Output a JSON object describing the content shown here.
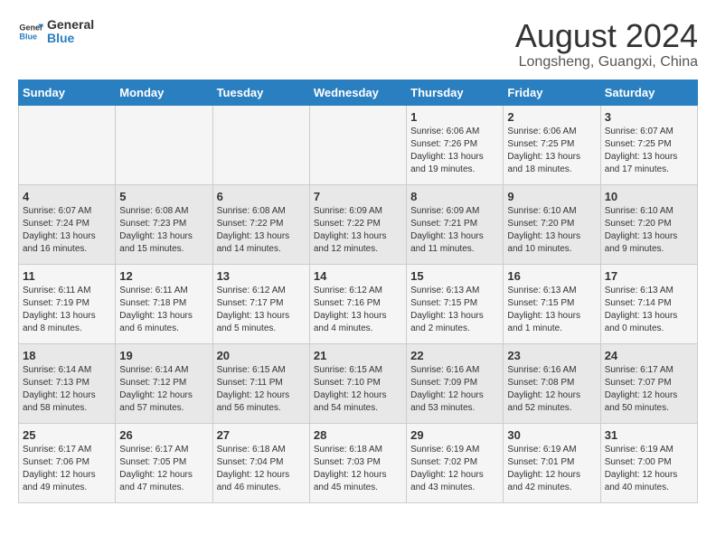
{
  "logo": {
    "line1": "General",
    "line2": "Blue"
  },
  "title": "August 2024",
  "location": "Longsheng, Guangxi, China",
  "weekdays": [
    "Sunday",
    "Monday",
    "Tuesday",
    "Wednesday",
    "Thursday",
    "Friday",
    "Saturday"
  ],
  "weeks": [
    [
      {
        "day": "",
        "text": ""
      },
      {
        "day": "",
        "text": ""
      },
      {
        "day": "",
        "text": ""
      },
      {
        "day": "",
        "text": ""
      },
      {
        "day": "1",
        "text": "Sunrise: 6:06 AM\nSunset: 7:26 PM\nDaylight: 13 hours\nand 19 minutes."
      },
      {
        "day": "2",
        "text": "Sunrise: 6:06 AM\nSunset: 7:25 PM\nDaylight: 13 hours\nand 18 minutes."
      },
      {
        "day": "3",
        "text": "Sunrise: 6:07 AM\nSunset: 7:25 PM\nDaylight: 13 hours\nand 17 minutes."
      }
    ],
    [
      {
        "day": "4",
        "text": "Sunrise: 6:07 AM\nSunset: 7:24 PM\nDaylight: 13 hours\nand 16 minutes."
      },
      {
        "day": "5",
        "text": "Sunrise: 6:08 AM\nSunset: 7:23 PM\nDaylight: 13 hours\nand 15 minutes."
      },
      {
        "day": "6",
        "text": "Sunrise: 6:08 AM\nSunset: 7:22 PM\nDaylight: 13 hours\nand 14 minutes."
      },
      {
        "day": "7",
        "text": "Sunrise: 6:09 AM\nSunset: 7:22 PM\nDaylight: 13 hours\nand 12 minutes."
      },
      {
        "day": "8",
        "text": "Sunrise: 6:09 AM\nSunset: 7:21 PM\nDaylight: 13 hours\nand 11 minutes."
      },
      {
        "day": "9",
        "text": "Sunrise: 6:10 AM\nSunset: 7:20 PM\nDaylight: 13 hours\nand 10 minutes."
      },
      {
        "day": "10",
        "text": "Sunrise: 6:10 AM\nSunset: 7:20 PM\nDaylight: 13 hours\nand 9 minutes."
      }
    ],
    [
      {
        "day": "11",
        "text": "Sunrise: 6:11 AM\nSunset: 7:19 PM\nDaylight: 13 hours\nand 8 minutes."
      },
      {
        "day": "12",
        "text": "Sunrise: 6:11 AM\nSunset: 7:18 PM\nDaylight: 13 hours\nand 6 minutes."
      },
      {
        "day": "13",
        "text": "Sunrise: 6:12 AM\nSunset: 7:17 PM\nDaylight: 13 hours\nand 5 minutes."
      },
      {
        "day": "14",
        "text": "Sunrise: 6:12 AM\nSunset: 7:16 PM\nDaylight: 13 hours\nand 4 minutes."
      },
      {
        "day": "15",
        "text": "Sunrise: 6:13 AM\nSunset: 7:15 PM\nDaylight: 13 hours\nand 2 minutes."
      },
      {
        "day": "16",
        "text": "Sunrise: 6:13 AM\nSunset: 7:15 PM\nDaylight: 13 hours\nand 1 minute."
      },
      {
        "day": "17",
        "text": "Sunrise: 6:13 AM\nSunset: 7:14 PM\nDaylight: 13 hours\nand 0 minutes."
      }
    ],
    [
      {
        "day": "18",
        "text": "Sunrise: 6:14 AM\nSunset: 7:13 PM\nDaylight: 12 hours\nand 58 minutes."
      },
      {
        "day": "19",
        "text": "Sunrise: 6:14 AM\nSunset: 7:12 PM\nDaylight: 12 hours\nand 57 minutes."
      },
      {
        "day": "20",
        "text": "Sunrise: 6:15 AM\nSunset: 7:11 PM\nDaylight: 12 hours\nand 56 minutes."
      },
      {
        "day": "21",
        "text": "Sunrise: 6:15 AM\nSunset: 7:10 PM\nDaylight: 12 hours\nand 54 minutes."
      },
      {
        "day": "22",
        "text": "Sunrise: 6:16 AM\nSunset: 7:09 PM\nDaylight: 12 hours\nand 53 minutes."
      },
      {
        "day": "23",
        "text": "Sunrise: 6:16 AM\nSunset: 7:08 PM\nDaylight: 12 hours\nand 52 minutes."
      },
      {
        "day": "24",
        "text": "Sunrise: 6:17 AM\nSunset: 7:07 PM\nDaylight: 12 hours\nand 50 minutes."
      }
    ],
    [
      {
        "day": "25",
        "text": "Sunrise: 6:17 AM\nSunset: 7:06 PM\nDaylight: 12 hours\nand 49 minutes."
      },
      {
        "day": "26",
        "text": "Sunrise: 6:17 AM\nSunset: 7:05 PM\nDaylight: 12 hours\nand 47 minutes."
      },
      {
        "day": "27",
        "text": "Sunrise: 6:18 AM\nSunset: 7:04 PM\nDaylight: 12 hours\nand 46 minutes."
      },
      {
        "day": "28",
        "text": "Sunrise: 6:18 AM\nSunset: 7:03 PM\nDaylight: 12 hours\nand 45 minutes."
      },
      {
        "day": "29",
        "text": "Sunrise: 6:19 AM\nSunset: 7:02 PM\nDaylight: 12 hours\nand 43 minutes."
      },
      {
        "day": "30",
        "text": "Sunrise: 6:19 AM\nSunset: 7:01 PM\nDaylight: 12 hours\nand 42 minutes."
      },
      {
        "day": "31",
        "text": "Sunrise: 6:19 AM\nSunset: 7:00 PM\nDaylight: 12 hours\nand 40 minutes."
      }
    ]
  ]
}
